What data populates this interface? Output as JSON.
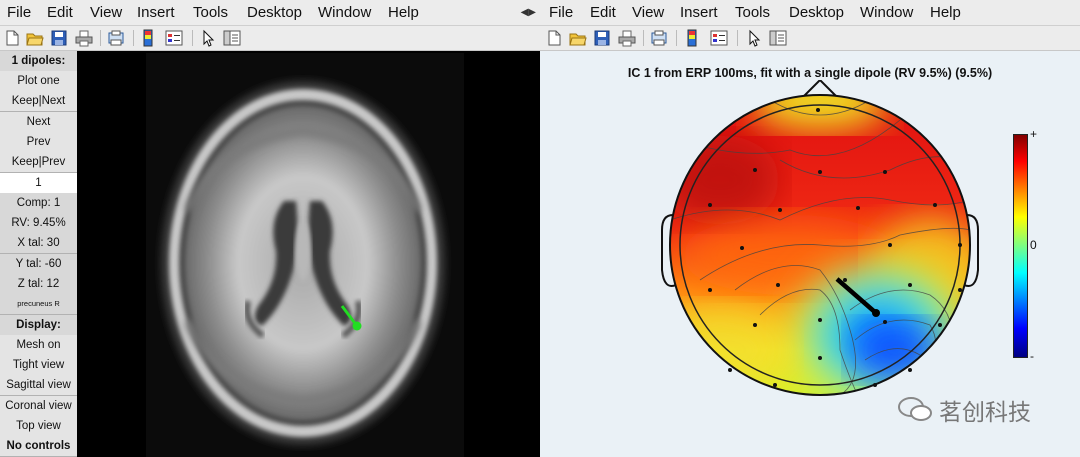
{
  "menus": {
    "left": [
      "File",
      "Edit",
      "View",
      "Insert",
      "Tools",
      "Desktop",
      "Window",
      "Help"
    ],
    "right": [
      "File",
      "Edit",
      "View",
      "Insert",
      "Tools",
      "Desktop",
      "Window",
      "Help"
    ]
  },
  "panel": {
    "title": "1 dipoles:",
    "plot_one": "Plot one",
    "keep_next": "Keep|Next",
    "next": "Next",
    "prev": "Prev",
    "keep_prev": "Keep|Prev",
    "index_value": "1",
    "comp": "Comp: 1",
    "rv": "RV: 9.45%",
    "x_tal": "X tal: 30",
    "y_tal": "Y tal: -60",
    "z_tal": "Z tal: 12",
    "region": "precuneus R",
    "display_label": "Display:",
    "mesh_on": "Mesh on",
    "tight_view": "Tight view",
    "sagittal_view": "Sagittal view",
    "coronal_view": "Coronal view",
    "top_view": "Top view",
    "no_controls": "No controls"
  },
  "figure": {
    "title": "IC 1 from ERP 100ms, fit with a single dipole (RV 9.5%) (9.5%)",
    "colorbar_ticks": [
      "+",
      "0",
      "-"
    ]
  },
  "colors": {
    "dipole_left": "#22dd22",
    "dipole_right": "#000000",
    "toolbar_bg": "#ececec"
  },
  "watermark": {
    "text": "茗创科技"
  },
  "icons": [
    "new-figure-icon",
    "open-file-icon",
    "save-icon",
    "print-icon",
    "print-preview-icon",
    "link-icon",
    "insert-colorbar-icon",
    "insert-legend-icon",
    "select-pointer-icon",
    "property-editor-icon"
  ]
}
